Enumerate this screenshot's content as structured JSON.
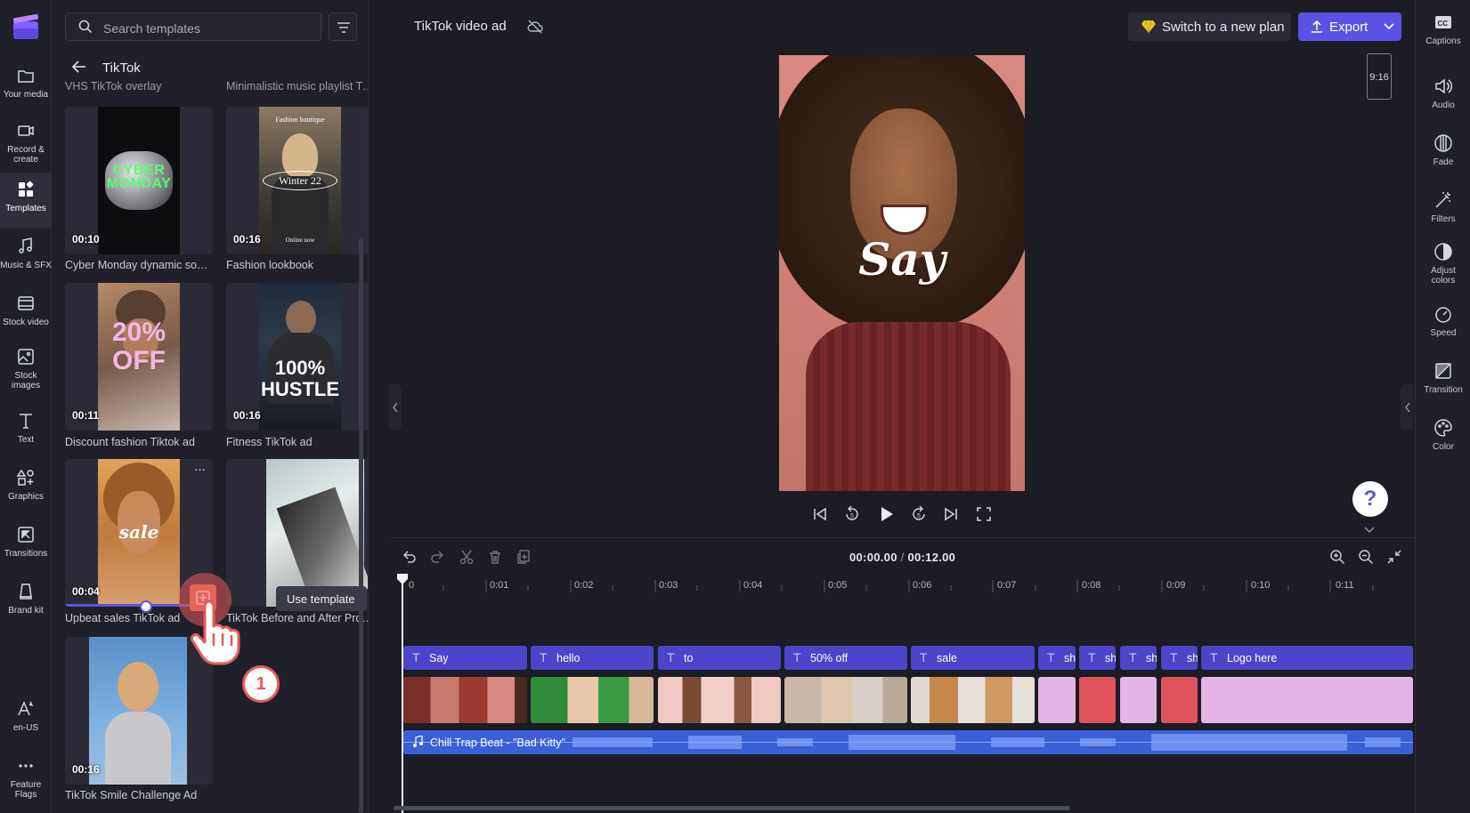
{
  "app": {
    "project_title": "TikTok video ad"
  },
  "nav": {
    "items": [
      {
        "label": "Your media",
        "icon": "folder-icon"
      },
      {
        "label": "Record & create",
        "icon": "camera-icon"
      },
      {
        "label": "Templates",
        "icon": "templates-icon"
      },
      {
        "label": "Music & SFX",
        "icon": "music-icon"
      },
      {
        "label": "Stock video",
        "icon": "film-icon"
      },
      {
        "label": "Stock images",
        "icon": "image-icon"
      },
      {
        "label": "Text",
        "icon": "text-icon"
      },
      {
        "label": "Graphics",
        "icon": "shapes-icon"
      },
      {
        "label": "Transitions",
        "icon": "transition-icon"
      },
      {
        "label": "Brand kit",
        "icon": "brand-icon"
      },
      {
        "label": "en-US",
        "icon": "language-icon"
      },
      {
        "label": "Feature Flags",
        "icon": "more-icon"
      }
    ]
  },
  "panel": {
    "search_placeholder": "Search templates",
    "back_title": "TikTok",
    "partial_labels": [
      "VHS TikTok overlay",
      "Minimalistic music playlist Tik..."
    ],
    "cards": [
      {
        "label": "Cyber Monday dynamic socia...",
        "duration": "00:10",
        "thumb_text": "CYBER MONDAY"
      },
      {
        "label": "Fashion lookbook",
        "duration": "00:16",
        "thumb_text": "Winter 22",
        "thumb_top": "Fashion boutique",
        "thumb_bottom": "Online now"
      },
      {
        "label": "Discount fashion Tiktok ad",
        "duration": "00:11",
        "thumb_text": "20% OFF"
      },
      {
        "label": "Fitness TikTok ad",
        "duration": "00:16",
        "thumb_text": "100% HUSTLE"
      },
      {
        "label": "Upbeat sales TikTok ad",
        "duration": "00:04",
        "thumb_text": "sale",
        "menu": "···"
      },
      {
        "label": "TikTok Before and After Promo",
        "duration": ""
      },
      {
        "label": "TikTok Smile Challenge Ad",
        "duration": "00:16"
      }
    ],
    "tooltip": "Use template",
    "step_badge": "1"
  },
  "topbar": {
    "plan_button": "Switch to a new plan",
    "export_button": "Export"
  },
  "preview": {
    "overlay_text": "Say",
    "aspect_ratio": "9:16"
  },
  "right_rail": [
    {
      "label": "Captions",
      "icon": "captions-icon"
    },
    {
      "label": "Audio",
      "icon": "speaker-icon"
    },
    {
      "label": "Fade",
      "icon": "fade-icon"
    },
    {
      "label": "Filters",
      "icon": "wand-icon"
    },
    {
      "label": "Adjust colors",
      "icon": "contrast-icon"
    },
    {
      "label": "Speed",
      "icon": "speedometer-icon"
    },
    {
      "label": "Transition",
      "icon": "transition-icon"
    },
    {
      "label": "Color",
      "icon": "palette-icon"
    }
  ],
  "timeline": {
    "current_time": "00:00.00",
    "total_time": "00:12.00",
    "ruler": [
      "0",
      "0:01",
      "0:02",
      "0:03",
      "0:04",
      "0:05",
      "0:06",
      "0:07",
      "0:08",
      "0:09",
      "0:10",
      "0:11"
    ],
    "text_clips": [
      "Say",
      "hello",
      "to",
      "50% off",
      "sale",
      "sh",
      "sh",
      "sh",
      "sh",
      "Logo here"
    ],
    "audio_track": "Chill Trap Beat - \"Bad Kitty\""
  },
  "colors": {
    "accent": "#5a52e6",
    "background": "#1b1c24",
    "text_clip": "#4d44c9",
    "audio_clip": "#3a5fd6"
  }
}
